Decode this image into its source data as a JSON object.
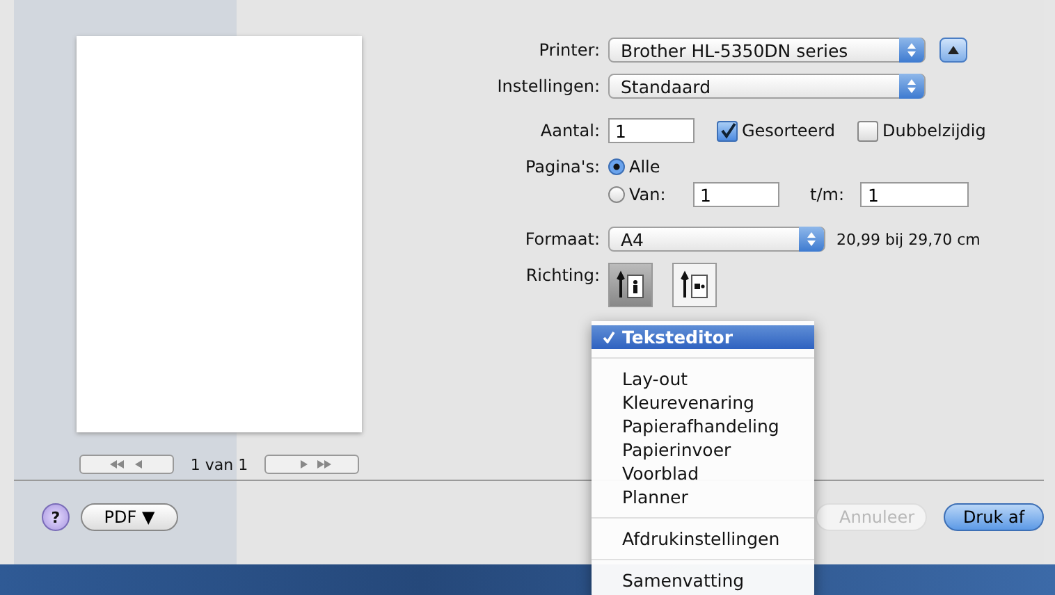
{
  "preview": {
    "page_counter": "1 van 1"
  },
  "form": {
    "printer": {
      "label": "Printer:",
      "value": "Brother HL-5350DN series"
    },
    "presets": {
      "label": "Instellingen:",
      "value": "Standaard"
    },
    "copies": {
      "label": "Aantal:",
      "value": "1"
    },
    "collated": {
      "label": "Gesorteerd",
      "checked": true
    },
    "two_sided": {
      "label": "Dubbelzijdig",
      "checked": false
    },
    "pages": {
      "label": "Pagina's:",
      "options": [
        {
          "label": "Alle",
          "selected": true
        },
        {
          "label": "Van:",
          "selected": false
        }
      ],
      "from": "1",
      "to_label": "t/m:",
      "to": "1"
    },
    "paper_size": {
      "label": "Formaat:",
      "value": "A4",
      "dimensions": "20,99 bij 29,70 cm"
    },
    "orientation": {
      "label": "Richting:",
      "options": [
        {
          "kind": "portrait",
          "selected": true
        },
        {
          "kind": "landscape",
          "selected": false
        }
      ]
    }
  },
  "panel_menu": {
    "groups": [
      [
        {
          "label": "Teksteditor",
          "checked": true,
          "selected": true
        }
      ],
      [
        {
          "label": "Lay-out",
          "checked": false,
          "selected": false
        },
        {
          "label": "Kleurevenaring",
          "checked": false,
          "selected": false
        },
        {
          "label": "Papierafhandeling",
          "checked": false,
          "selected": false
        },
        {
          "label": "Papierinvoer",
          "checked": false,
          "selected": false
        },
        {
          "label": "Voorblad",
          "checked": false,
          "selected": false
        },
        {
          "label": "Planner",
          "checked": false,
          "selected": false
        }
      ],
      [
        {
          "label": "Afdrukinstellingen",
          "checked": false,
          "selected": false
        }
      ],
      [
        {
          "label": "Samenvatting",
          "checked": false,
          "selected": false
        }
      ]
    ]
  },
  "buttons": {
    "help": "?",
    "pdf": "PDF ▼",
    "cancel": "Annuleer",
    "print": "Druk af"
  }
}
